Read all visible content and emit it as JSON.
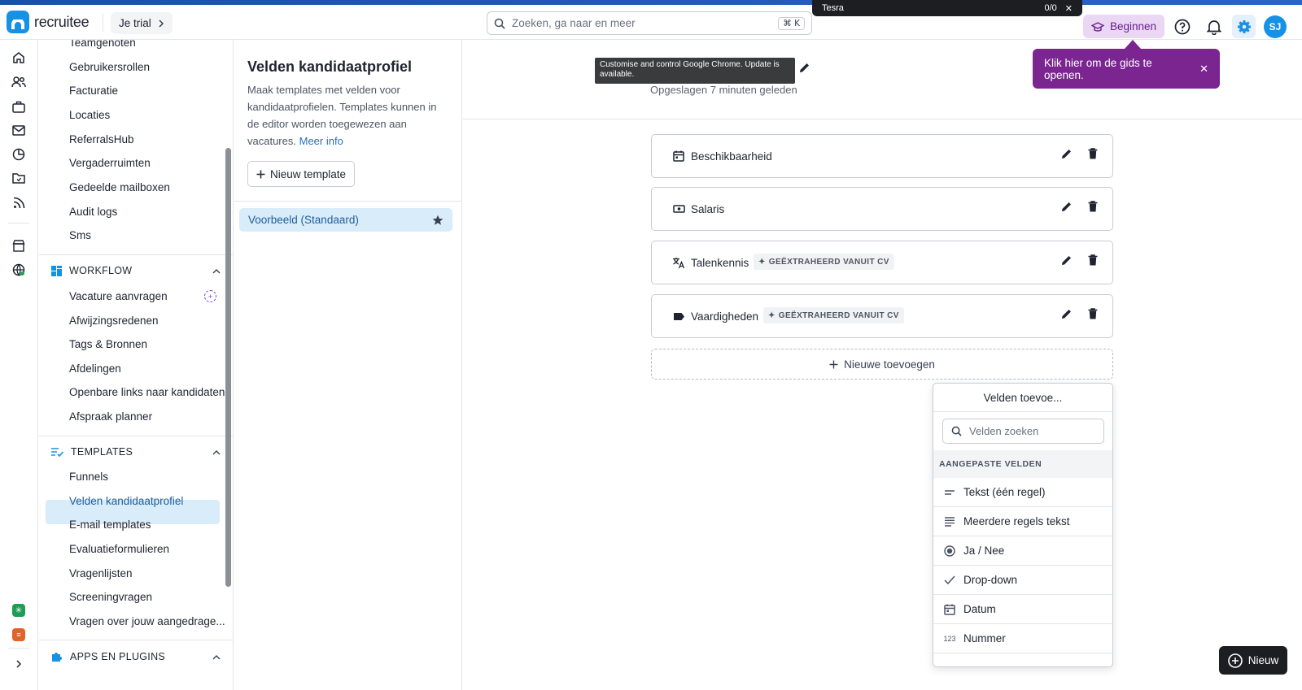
{
  "topbar": {
    "logo_text": "recruitee",
    "trial_label": "Je trial",
    "search_placeholder": "Zoeken, ga naar en meer",
    "search_shortcut": "⌘ K",
    "toast_text": "Tesra",
    "toast_counter": "0/0",
    "begin_label": "Beginnen",
    "avatar_initials": "SJ"
  },
  "sidebar": {
    "items_top": [
      "Teamgenoten",
      "Gebruikersrollen",
      "Facturatie",
      "Locaties",
      "ReferralsHub",
      "Vergaderruimten",
      "Gedeelde mailboxen",
      "Audit logs",
      "Sms"
    ],
    "workflow": {
      "label": "WORKFLOW",
      "items": [
        "Vacature aanvragen",
        "Afwijzingsredenen",
        "Tags & Bronnen",
        "Afdelingen",
        "Openbare links naar kandidaten",
        "Afspraak planner"
      ]
    },
    "templates": {
      "label": "TEMPLATES",
      "items": [
        "Funnels",
        "Velden kandidaatprofiel",
        "E-mail templates",
        "Evaluatieformulieren",
        "Vragenlijsten",
        "Screeningvragen",
        "Vragen over jouw aangedrage..."
      ]
    },
    "apps": {
      "label": "APPS EN PLUGINS"
    }
  },
  "middle": {
    "title": "Velden kandidaatprofiel",
    "description": "Maak templates met velden voor kandidaatprofielen. Templates kunnen in de editor worden toegewezen aan vacatures.",
    "more_info": "Meer info",
    "new_template": "Nieuw template",
    "template_name": "Voorbeeld (Standaard)"
  },
  "main": {
    "tooltip": "Customise and control Google Chrome. Update is available.",
    "saved_text": "Opgeslagen 7 minuten geleden",
    "fields": [
      {
        "label": "Beschikbaarheid",
        "tag": ""
      },
      {
        "label": "Salaris",
        "tag": ""
      },
      {
        "label": "Talenkennis",
        "tag": "GEËXTRAHEERD VANUIT CV"
      },
      {
        "label": "Vaardigheden",
        "tag": "GEËXTRAHEERD VANUIT CV"
      }
    ],
    "add_new": "Nieuwe toevoegen",
    "guide_text": "Klik hier om de gids te openen."
  },
  "dropdown": {
    "title": "Velden toevoe...",
    "search_placeholder": "Velden zoeken",
    "section": "AANGEPASTE VELDEN",
    "items": [
      "Tekst (één regel)",
      "Meerdere regels tekst",
      "Ja / Nee",
      "Drop-down",
      "Datum",
      "Nummer"
    ]
  },
  "fab": {
    "label": "Nieuw"
  },
  "colors": {
    "brand": "#1592e6",
    "active_bg": "#d9ecfa",
    "guide": "#7b2590",
    "begin_bg": "#ead7f4"
  }
}
